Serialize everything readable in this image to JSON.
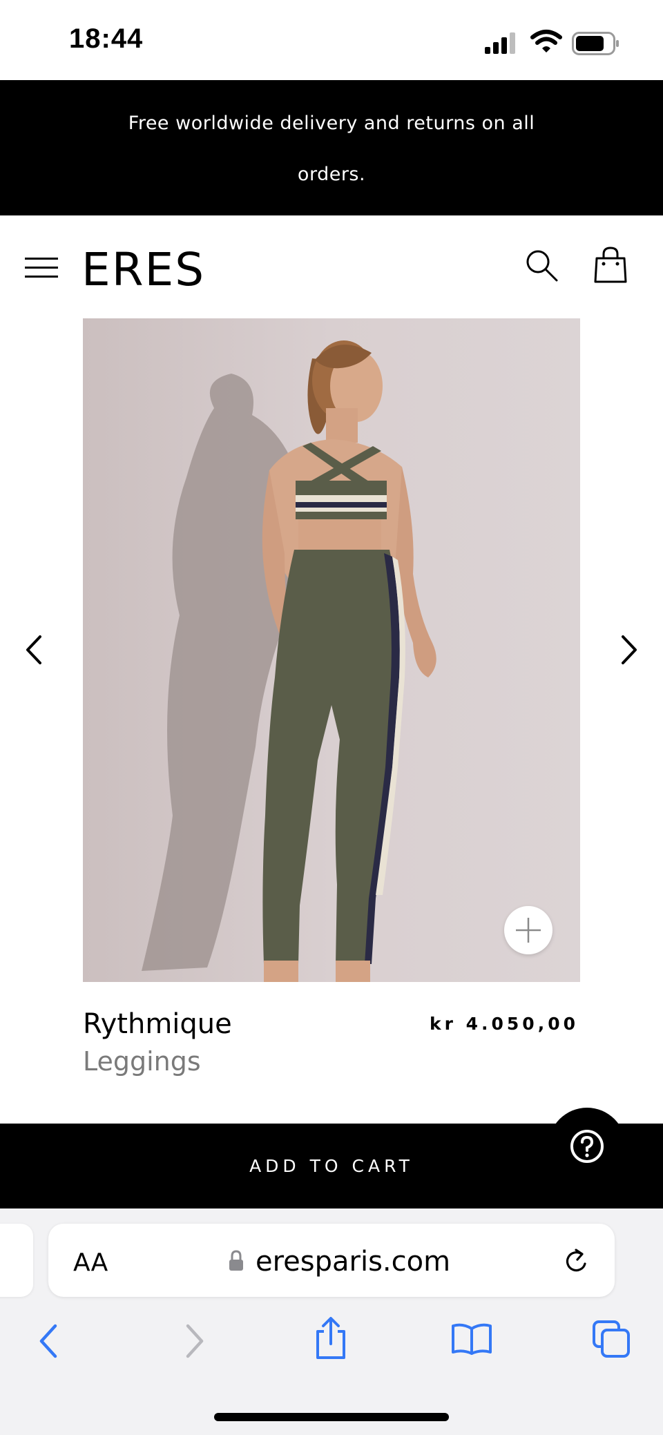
{
  "status_bar": {
    "time": "18:44",
    "icons": [
      "cellular-signal-icon",
      "wifi-icon",
      "battery-icon"
    ]
  },
  "promo_banner": {
    "text": "Free worldwide delivery and returns on all orders."
  },
  "header": {
    "logo": "ERES",
    "icons": [
      "menu-icon",
      "search-icon",
      "shopping-bag-icon"
    ]
  },
  "product": {
    "image_alt": "Rythmique Leggings",
    "name": "Rythmique",
    "type": "Leggings",
    "price": "kr 4.050,00",
    "colors": {
      "khaki": "#5a5d49",
      "stripe_navy": "#2a2a45",
      "stripe_cream": "#e9e2d4"
    }
  },
  "cart": {
    "add_label": "ADD TO CART"
  },
  "browser": {
    "text_size_label": "AA",
    "url": "eresparis.com",
    "accent_color": "#3478f6",
    "toolbar_icons": [
      "back-icon",
      "forward-icon",
      "share-icon",
      "bookmarks-icon",
      "tabs-icon"
    ]
  }
}
